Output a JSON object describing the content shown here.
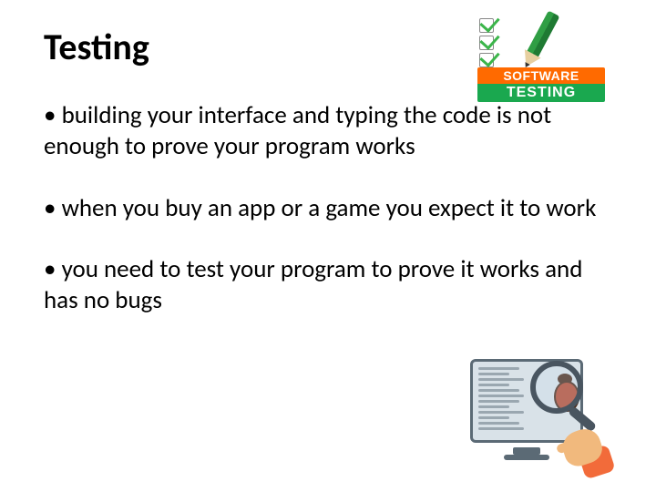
{
  "title": "Testing",
  "bullets": [
    "building your interface and typing the code is not enough to prove your program works",
    "when you buy an app or a game you expect it to work",
    "you need to test your program to prove it works and has no bugs"
  ],
  "illustration_top": {
    "label_top": "SOFTWARE",
    "label_bottom": "TESTING"
  }
}
